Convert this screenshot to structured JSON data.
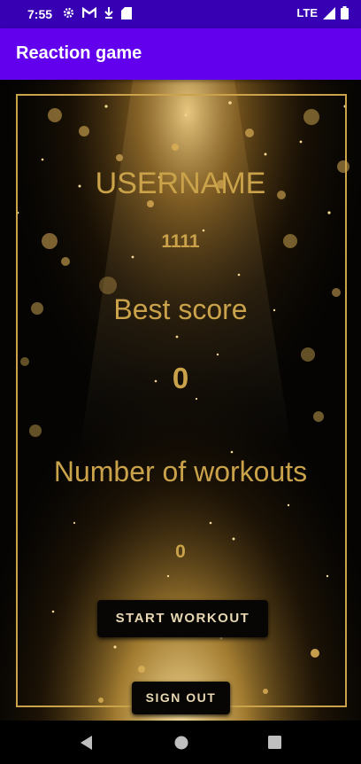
{
  "status_bar": {
    "time": "7:55",
    "network": "LTE",
    "left_icons": [
      "settings-icon",
      "gmail-icon",
      "download-arrow-icon",
      "sd-card-icon"
    ],
    "right_icons": [
      "signal-icon",
      "battery-icon"
    ]
  },
  "app_bar": {
    "title": "Reaction game",
    "color": "#6200EE",
    "status_color": "#3700B3"
  },
  "profile": {
    "username_label": "USERNAME",
    "username_value": "1111",
    "best_score_label": "Best score",
    "best_score_value": "0",
    "workouts_label": "Number of workouts",
    "workouts_value": "0",
    "text_color": "#C9A24A"
  },
  "buttons": {
    "start_workout": "START WORKOUT",
    "sign_out": "SIGN OUT"
  },
  "nav_bar": {
    "icons": [
      "back-icon",
      "home-icon",
      "recents-icon"
    ]
  }
}
